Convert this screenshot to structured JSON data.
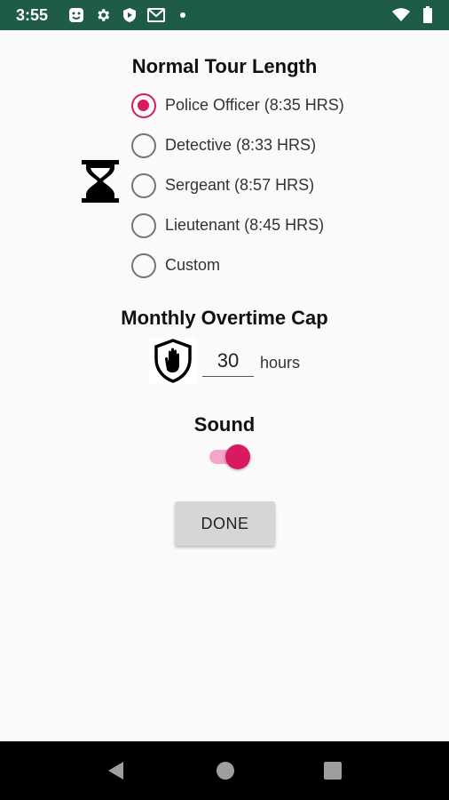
{
  "status_bar": {
    "time": "3:55",
    "left_icons": [
      "face-icon",
      "gear-icon",
      "shield-play-icon",
      "mail-icon",
      "dot-icon"
    ],
    "right_icons": [
      "wifi-icon",
      "battery-icon"
    ],
    "background": "#1f5c47"
  },
  "tour_length": {
    "title": "Normal Tour Length",
    "icon": "hourglass-icon",
    "options": [
      {
        "label": "Police Officer (8:35 HRS)",
        "checked": true
      },
      {
        "label": "Detective (8:33 HRS)",
        "checked": false
      },
      {
        "label": "Sergeant (8:57 HRS)",
        "checked": false
      },
      {
        "label": "Lieutenant (8:45 HRS)",
        "checked": false
      },
      {
        "label": "Custom",
        "checked": false
      }
    ]
  },
  "overtime": {
    "title": "Monthly Overtime Cap",
    "icon": "shield-hand-icon",
    "value": "30",
    "unit": "hours"
  },
  "sound": {
    "title": "Sound",
    "enabled": true
  },
  "done_label": "DONE",
  "colors": {
    "accent": "#d81b60",
    "accent_light": "#f3a6c6",
    "button_bg": "#d6d6d6"
  },
  "nav_bar": {
    "icons": [
      "back-icon",
      "home-icon",
      "recents-icon"
    ]
  }
}
